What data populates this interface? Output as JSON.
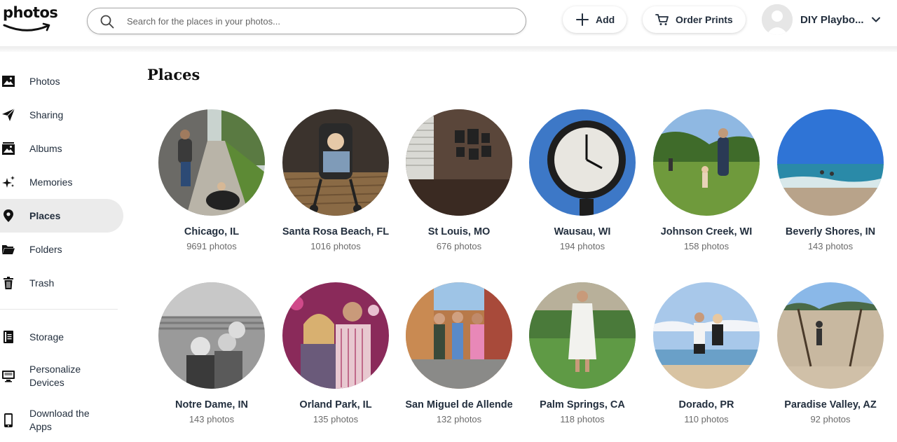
{
  "header": {
    "logo_text": "photos",
    "search_placeholder": "Search for the places in your photos...",
    "add_label": "Add",
    "order_prints_label": "Order Prints",
    "profile_name": "DIY Playbo..."
  },
  "sidebar": {
    "items": [
      {
        "label": "Photos",
        "icon": "image-icon"
      },
      {
        "label": "Sharing",
        "icon": "paper-plane-icon"
      },
      {
        "label": "Albums",
        "icon": "albums-icon"
      },
      {
        "label": "Memories",
        "icon": "sparkles-icon"
      },
      {
        "label": "Places",
        "icon": "map-pin-icon",
        "active": true
      },
      {
        "label": "Folders",
        "icon": "folder-icon"
      },
      {
        "label": "Trash",
        "icon": "trash-icon"
      },
      {
        "label": "Storage",
        "icon": "storage-icon"
      },
      {
        "label": "Personalize Devices",
        "icon": "monitor-icon"
      },
      {
        "label": "Download the Apps",
        "icon": "phone-icon"
      }
    ]
  },
  "main": {
    "title": "Places",
    "places": [
      {
        "name": "Chicago, IL",
        "count": "9691 photos"
      },
      {
        "name": "Santa Rosa Beach, FL",
        "count": "1016 photos"
      },
      {
        "name": "St Louis, MO",
        "count": "676 photos"
      },
      {
        "name": "Wausau, WI",
        "count": "194 photos"
      },
      {
        "name": "Johnson Creek, WI",
        "count": "158 photos"
      },
      {
        "name": "Beverly Shores, IN",
        "count": "143 photos"
      },
      {
        "name": "Notre Dame, IN",
        "count": "143 photos"
      },
      {
        "name": "Orland Park, IL",
        "count": "135 photos"
      },
      {
        "name": "San Miguel de Allende",
        "count": "132 photos"
      },
      {
        "name": "Palm Springs, CA",
        "count": "118 photos"
      },
      {
        "name": "Dorado, PR",
        "count": "110 photos"
      },
      {
        "name": "Paradise Valley, AZ",
        "count": "92 photos"
      }
    ]
  },
  "colors": {
    "text_primary": "#232f3e",
    "text_secondary": "#6b6b6b",
    "active_bg": "#ebebeb"
  }
}
